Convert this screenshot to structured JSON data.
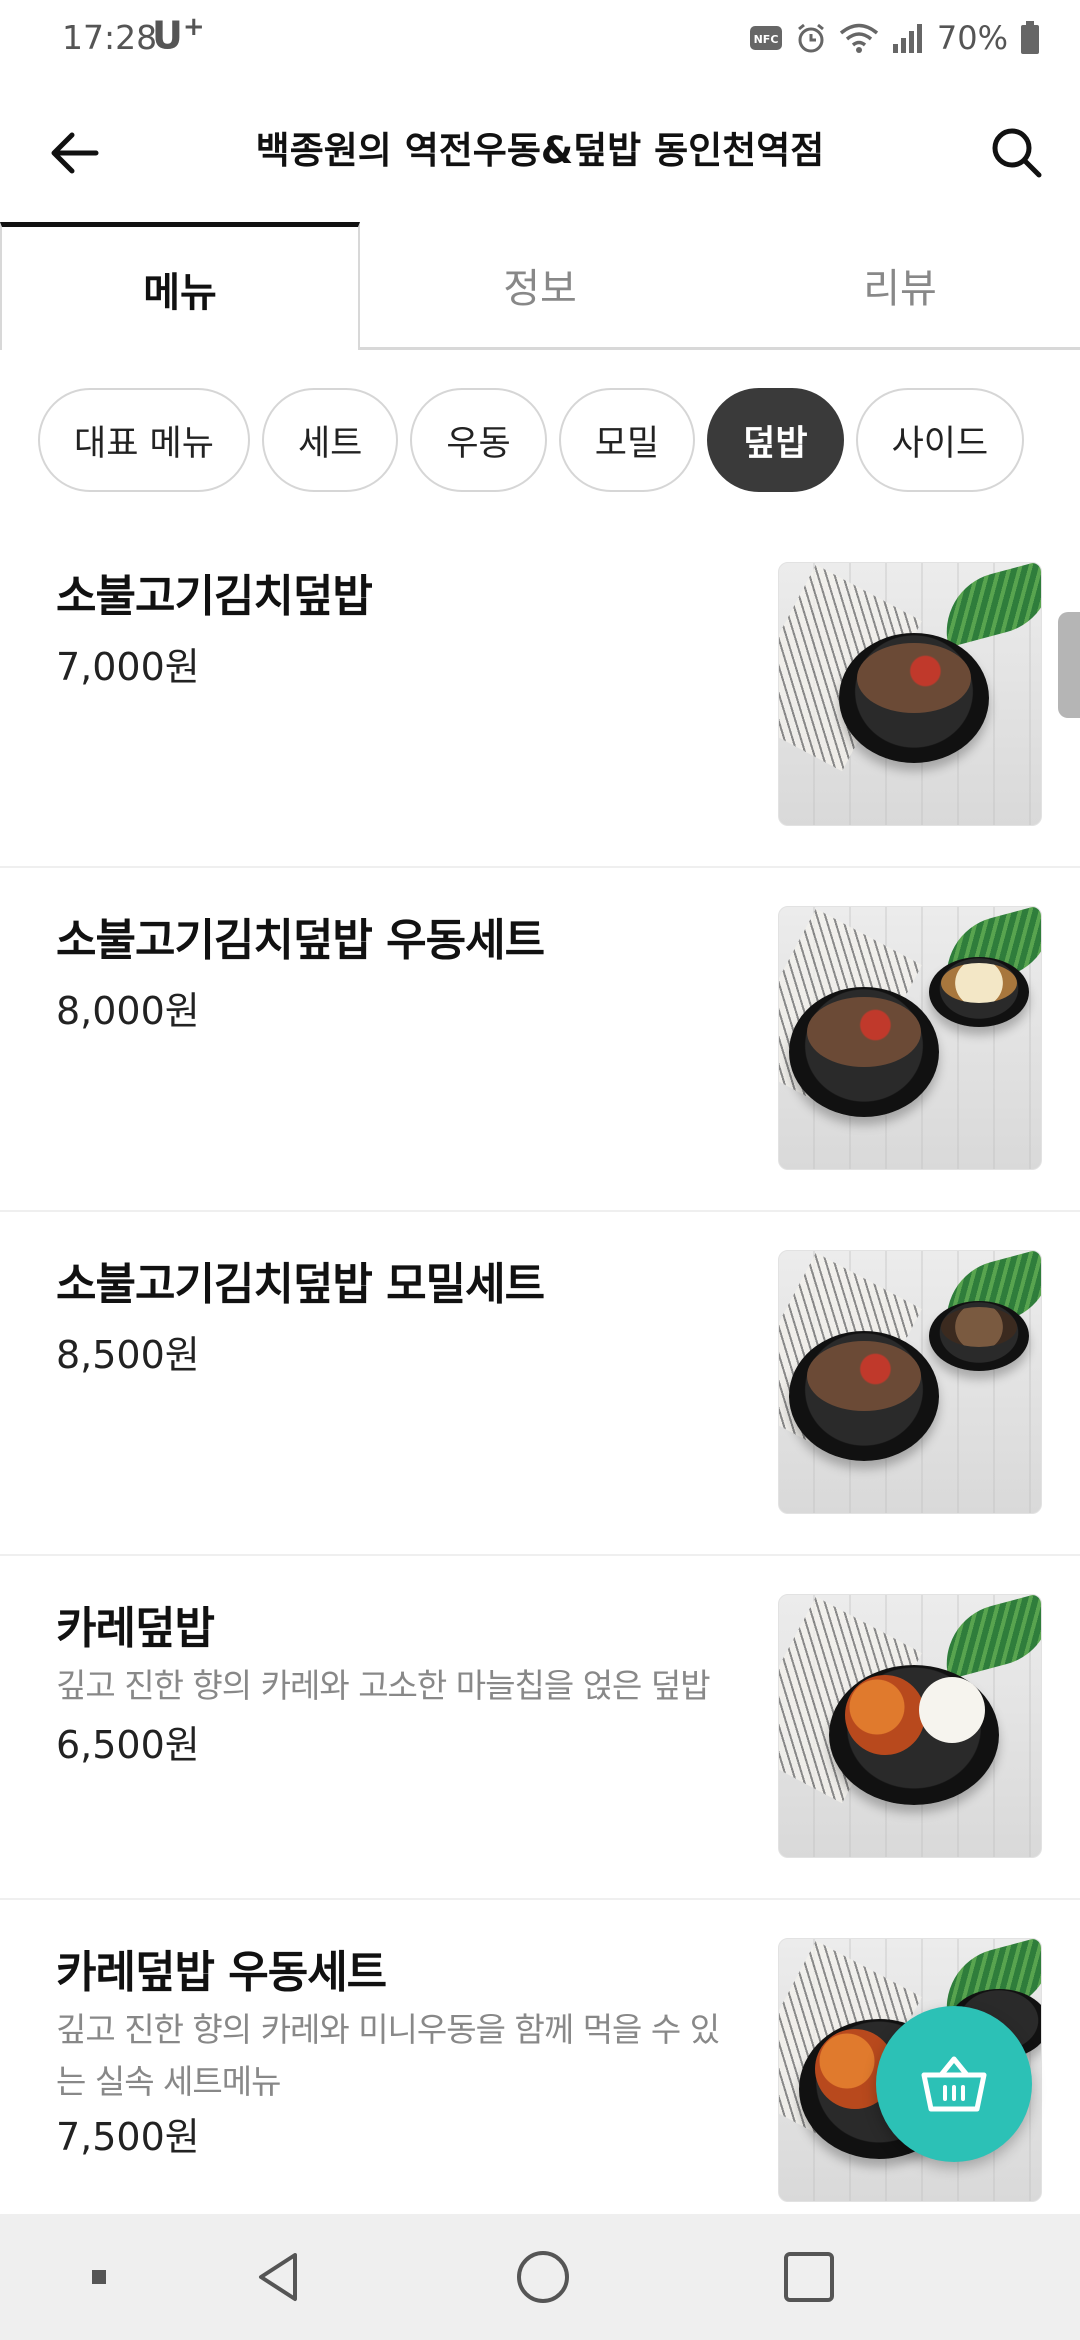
{
  "status_bar": {
    "time": "17:28",
    "carrier": "U",
    "carrier_sup": "+",
    "battery": "70%"
  },
  "header": {
    "store_title": "백종원의 역전우동&덮밥 동인천역점"
  },
  "tabs": [
    {
      "label": "메뉴",
      "active": true
    },
    {
      "label": "정보",
      "active": false
    },
    {
      "label": "리뷰",
      "active": false
    }
  ],
  "categories": [
    {
      "label": "대표 메뉴",
      "selected": false
    },
    {
      "label": "세트",
      "selected": false
    },
    {
      "label": "우동",
      "selected": false
    },
    {
      "label": "모밀",
      "selected": false
    },
    {
      "label": "덮밥",
      "selected": true
    },
    {
      "label": "사이드",
      "selected": false
    }
  ],
  "menu_items": [
    {
      "name": "소불고기김치덮밥",
      "description": "",
      "price": "7,000원"
    },
    {
      "name": "소불고기김치덮밥 우동세트",
      "description": "",
      "price": "8,000원"
    },
    {
      "name": "소불고기김치덮밥 모밀세트",
      "description": "",
      "price": "8,500원"
    },
    {
      "name": "카레덮밥",
      "description": "깊고 진한 향의 카레와 고소한 마늘칩을 얹은 덮밥",
      "price": "6,500원"
    },
    {
      "name": "카레덮밥 우동세트",
      "description": "깊고 진한 향의 카레와 미니우동을 함께 먹을 수 있는 실속 세트메뉴",
      "price": "7,500원"
    }
  ],
  "colors": {
    "accent_teal": "#2cc1b6",
    "chip_selected": "#3a3a3a"
  },
  "icons": [
    "back-arrow-icon",
    "search-icon",
    "cart-basket-icon",
    "nfc-icon",
    "alarm-icon",
    "wifi-icon",
    "signal-icon",
    "battery-icon"
  ]
}
